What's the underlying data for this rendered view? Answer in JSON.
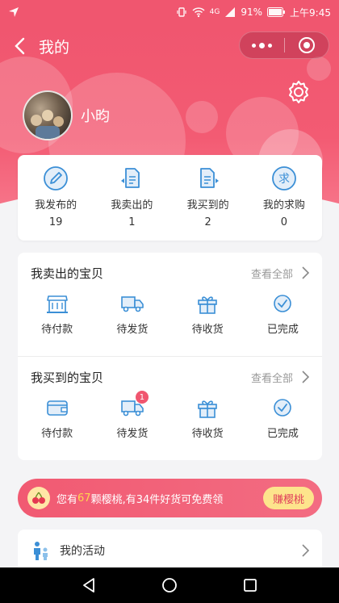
{
  "status_bar": {
    "signal": "4G",
    "battery": "91%",
    "time": "上午9:45"
  },
  "header": {
    "title": "我的",
    "nickname": "小昀"
  },
  "stats": [
    {
      "icon": "pen-icon",
      "label": "我发布的",
      "count": "19"
    },
    {
      "icon": "document-sold-icon",
      "label": "我卖出的",
      "count": "1"
    },
    {
      "icon": "document-bought-icon",
      "label": "我买到的",
      "count": "2"
    },
    {
      "icon": "request-icon",
      "label": "我的求购",
      "count": "0"
    }
  ],
  "sold": {
    "title": "我卖出的宝贝",
    "view_all": "查看全部",
    "items": [
      {
        "icon": "shop-icon",
        "label": "待付款"
      },
      {
        "icon": "truck-icon",
        "label": "待发货"
      },
      {
        "icon": "gift-icon",
        "label": "待收货"
      },
      {
        "icon": "check-circle-icon",
        "label": "已完成"
      }
    ]
  },
  "bought": {
    "title": "我买到的宝贝",
    "view_all": "查看全部",
    "items": [
      {
        "icon": "wallet-icon",
        "label": "待付款"
      },
      {
        "icon": "truck-icon",
        "label": "待发货",
        "badge": "1"
      },
      {
        "icon": "gift-icon",
        "label": "待收货"
      },
      {
        "icon": "check-circle-icon",
        "label": "已完成"
      }
    ]
  },
  "banner": {
    "prefix": "您有",
    "cherries": "67",
    "suffix": "颗樱桃,有34件好货可免费领",
    "button": "赚樱桃"
  },
  "activity": {
    "label": "我的活动"
  },
  "colors": {
    "brand": "#f0566f",
    "accent_blue": "#3b8fd6",
    "cherry_yellow": "#fde48c"
  }
}
